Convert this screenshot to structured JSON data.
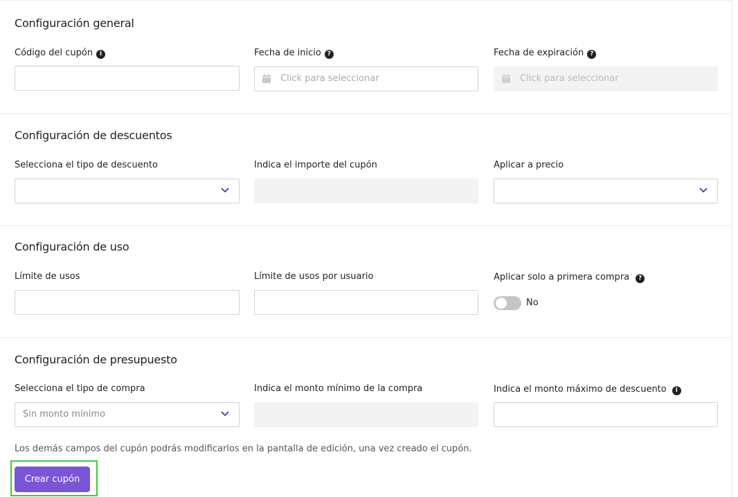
{
  "sections": {
    "general": {
      "title": "Configuración general",
      "coupon_code_label": "Código del cupón",
      "start_date_label": "Fecha de inicio",
      "start_date_placeholder": "Click para seleccionar",
      "expiry_date_label": "Fecha de expiración",
      "expiry_date_placeholder": "Click para seleccionar"
    },
    "discounts": {
      "title": "Configuración de descuentos",
      "discount_type_label": "Selecciona el tipo de descuento",
      "amount_label": "Indica el importe del cupón",
      "apply_price_label": "Aplicar a precio"
    },
    "usage": {
      "title": "Configuración de uso",
      "limit_label": "Límite de usos",
      "limit_per_user_label": "Límite de usos por usuario",
      "first_purchase_label": "Aplicar solo a primera compra",
      "first_purchase_value": "No"
    },
    "budget": {
      "title": "Configuración de presupuesto",
      "purchase_type_label": "Selecciona el tipo de compra",
      "purchase_type_value": "Sin monto mínimo",
      "min_amount_label": "Indica el monto mínimo de la compra",
      "max_discount_label": "Indica el monto máximo de descuento"
    }
  },
  "footnote": "Los demás campos del cupón podrás modificarlos en la pantalla de edición, una vez creado el cupón.",
  "create_button": "Crear cupón",
  "icons": {
    "info": "info-icon",
    "help": "question-icon",
    "calendar": "calendar-icon",
    "chevron": "chevron-down-icon"
  },
  "colors": {
    "primary": "#7a56d6",
    "highlight": "#3ec93e",
    "toggle_off": "#c4c4c4",
    "disabled_bg": "#f3f3f3"
  }
}
